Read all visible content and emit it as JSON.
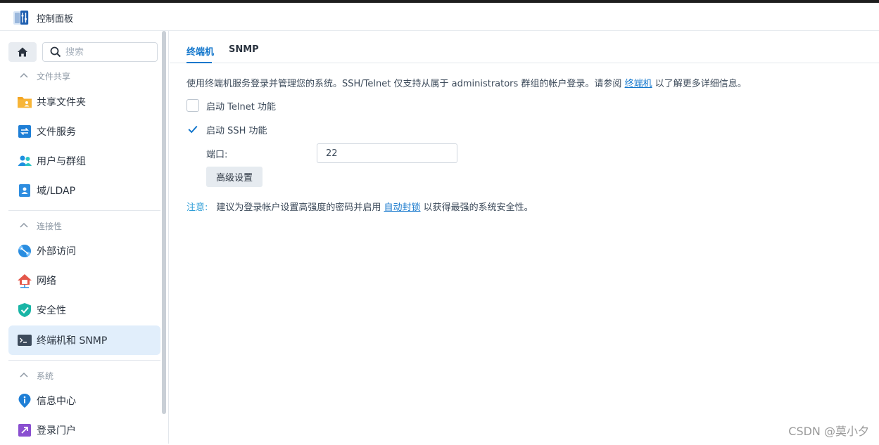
{
  "window": {
    "title": "控制面板"
  },
  "search": {
    "placeholder": "搜索"
  },
  "sidebar": {
    "sections": [
      {
        "title": "文件共享",
        "items": [
          {
            "label": "共享文件夹",
            "icon": "shared-folder-icon"
          },
          {
            "label": "文件服务",
            "icon": "file-services-icon"
          },
          {
            "label": "用户与群组",
            "icon": "users-groups-icon"
          },
          {
            "label": "域/LDAP",
            "icon": "domain-ldap-icon"
          }
        ]
      },
      {
        "title": "连接性",
        "items": [
          {
            "label": "外部访问",
            "icon": "external-access-icon"
          },
          {
            "label": "网络",
            "icon": "network-icon"
          },
          {
            "label": "安全性",
            "icon": "security-shield-icon"
          },
          {
            "label": "终端机和 SNMP",
            "icon": "terminal-icon",
            "active": true
          }
        ]
      },
      {
        "title": "系统",
        "items": [
          {
            "label": "信息中心",
            "icon": "info-center-icon"
          },
          {
            "label": "登录门户",
            "icon": "login-portal-icon"
          }
        ]
      }
    ]
  },
  "tabs": [
    {
      "label": "终端机",
      "active": true
    },
    {
      "label": "SNMP",
      "active": false
    }
  ],
  "content": {
    "description_before": "使用终端机服务登录并管理您的系统。SSH/Telnet 仅支持从属于 administrators 群组的帐户登录。请参阅 ",
    "description_link": "终端机",
    "description_after": " 以了解更多详细信息。",
    "telnet": {
      "label": "启动 Telnet 功能",
      "checked": false
    },
    "ssh": {
      "label": "启动 SSH 功能",
      "checked": true
    },
    "port_label": "端口:",
    "port_value": "22",
    "advanced_button": "高级设置",
    "note_label": "注意:",
    "note_before": "建议为登录帐户设置高强度的密码并启用 ",
    "note_link": "自动封锁",
    "note_after": " 以获得最强的系统安全性。"
  },
  "colors": {
    "accent": "#1477cc",
    "active_bg": "#e1eefb",
    "note": "#2f9ed7"
  },
  "watermark": "CSDN @莫小夕"
}
